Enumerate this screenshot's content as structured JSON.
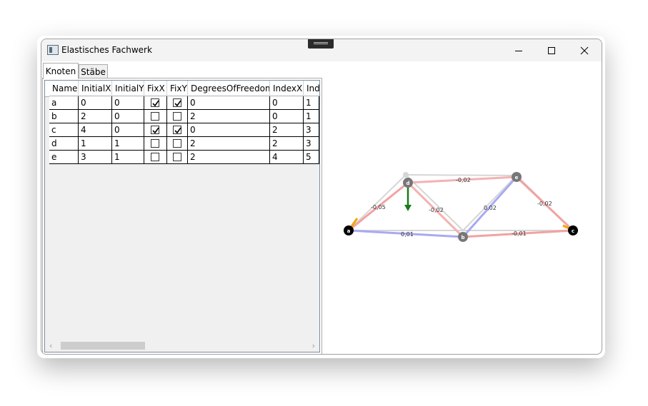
{
  "window": {
    "title": "Elastisches Fachwerk"
  },
  "tabs": [
    {
      "label": "Knoten",
      "selected": true
    },
    {
      "label": "Stäbe",
      "selected": false
    }
  ],
  "table": {
    "columns": [
      "Name",
      "InitialX",
      "InitialY",
      "FixX",
      "FixY",
      "DegreesOfFreedom",
      "IndexX",
      "Ind"
    ],
    "rows": [
      {
        "name": "a",
        "initial_x": "0",
        "initial_y": "0",
        "fix_x": true,
        "fix_y": true,
        "dof": "0",
        "index_x": "0",
        "index_y": "1"
      },
      {
        "name": "b",
        "initial_x": "2",
        "initial_y": "0",
        "fix_x": false,
        "fix_y": false,
        "dof": "2",
        "index_x": "0",
        "index_y": "1"
      },
      {
        "name": "c",
        "initial_x": "4",
        "initial_y": "0",
        "fix_x": true,
        "fix_y": true,
        "dof": "0",
        "index_x": "2",
        "index_y": "3"
      },
      {
        "name": "d",
        "initial_x": "1",
        "initial_y": "1",
        "fix_x": false,
        "fix_y": false,
        "dof": "2",
        "index_x": "2",
        "index_y": "3"
      },
      {
        "name": "e",
        "initial_x": "3",
        "initial_y": "1",
        "fix_x": false,
        "fix_y": false,
        "dof": "2",
        "index_x": "4",
        "index_y": "5"
      }
    ]
  },
  "truss": {
    "nodes": {
      "a": "a",
      "b": "b",
      "c": "c",
      "d": "d",
      "e": "e"
    },
    "member_labels": {
      "ad": "-0,05",
      "de": "-0,02",
      "db": "-0,02",
      "be": "0,02",
      "ec": "-0,02",
      "ab": "0,01",
      "bc": "-0,01"
    },
    "colors": {
      "compression": "#f2a2a2",
      "tension": "#a9a9f2",
      "undeformed": "#d6d6d6",
      "load_arrow": "#1b7a1b",
      "reaction_arrow": "#f0a500",
      "fixed_node": "#000000",
      "free_node": "#777777"
    }
  }
}
